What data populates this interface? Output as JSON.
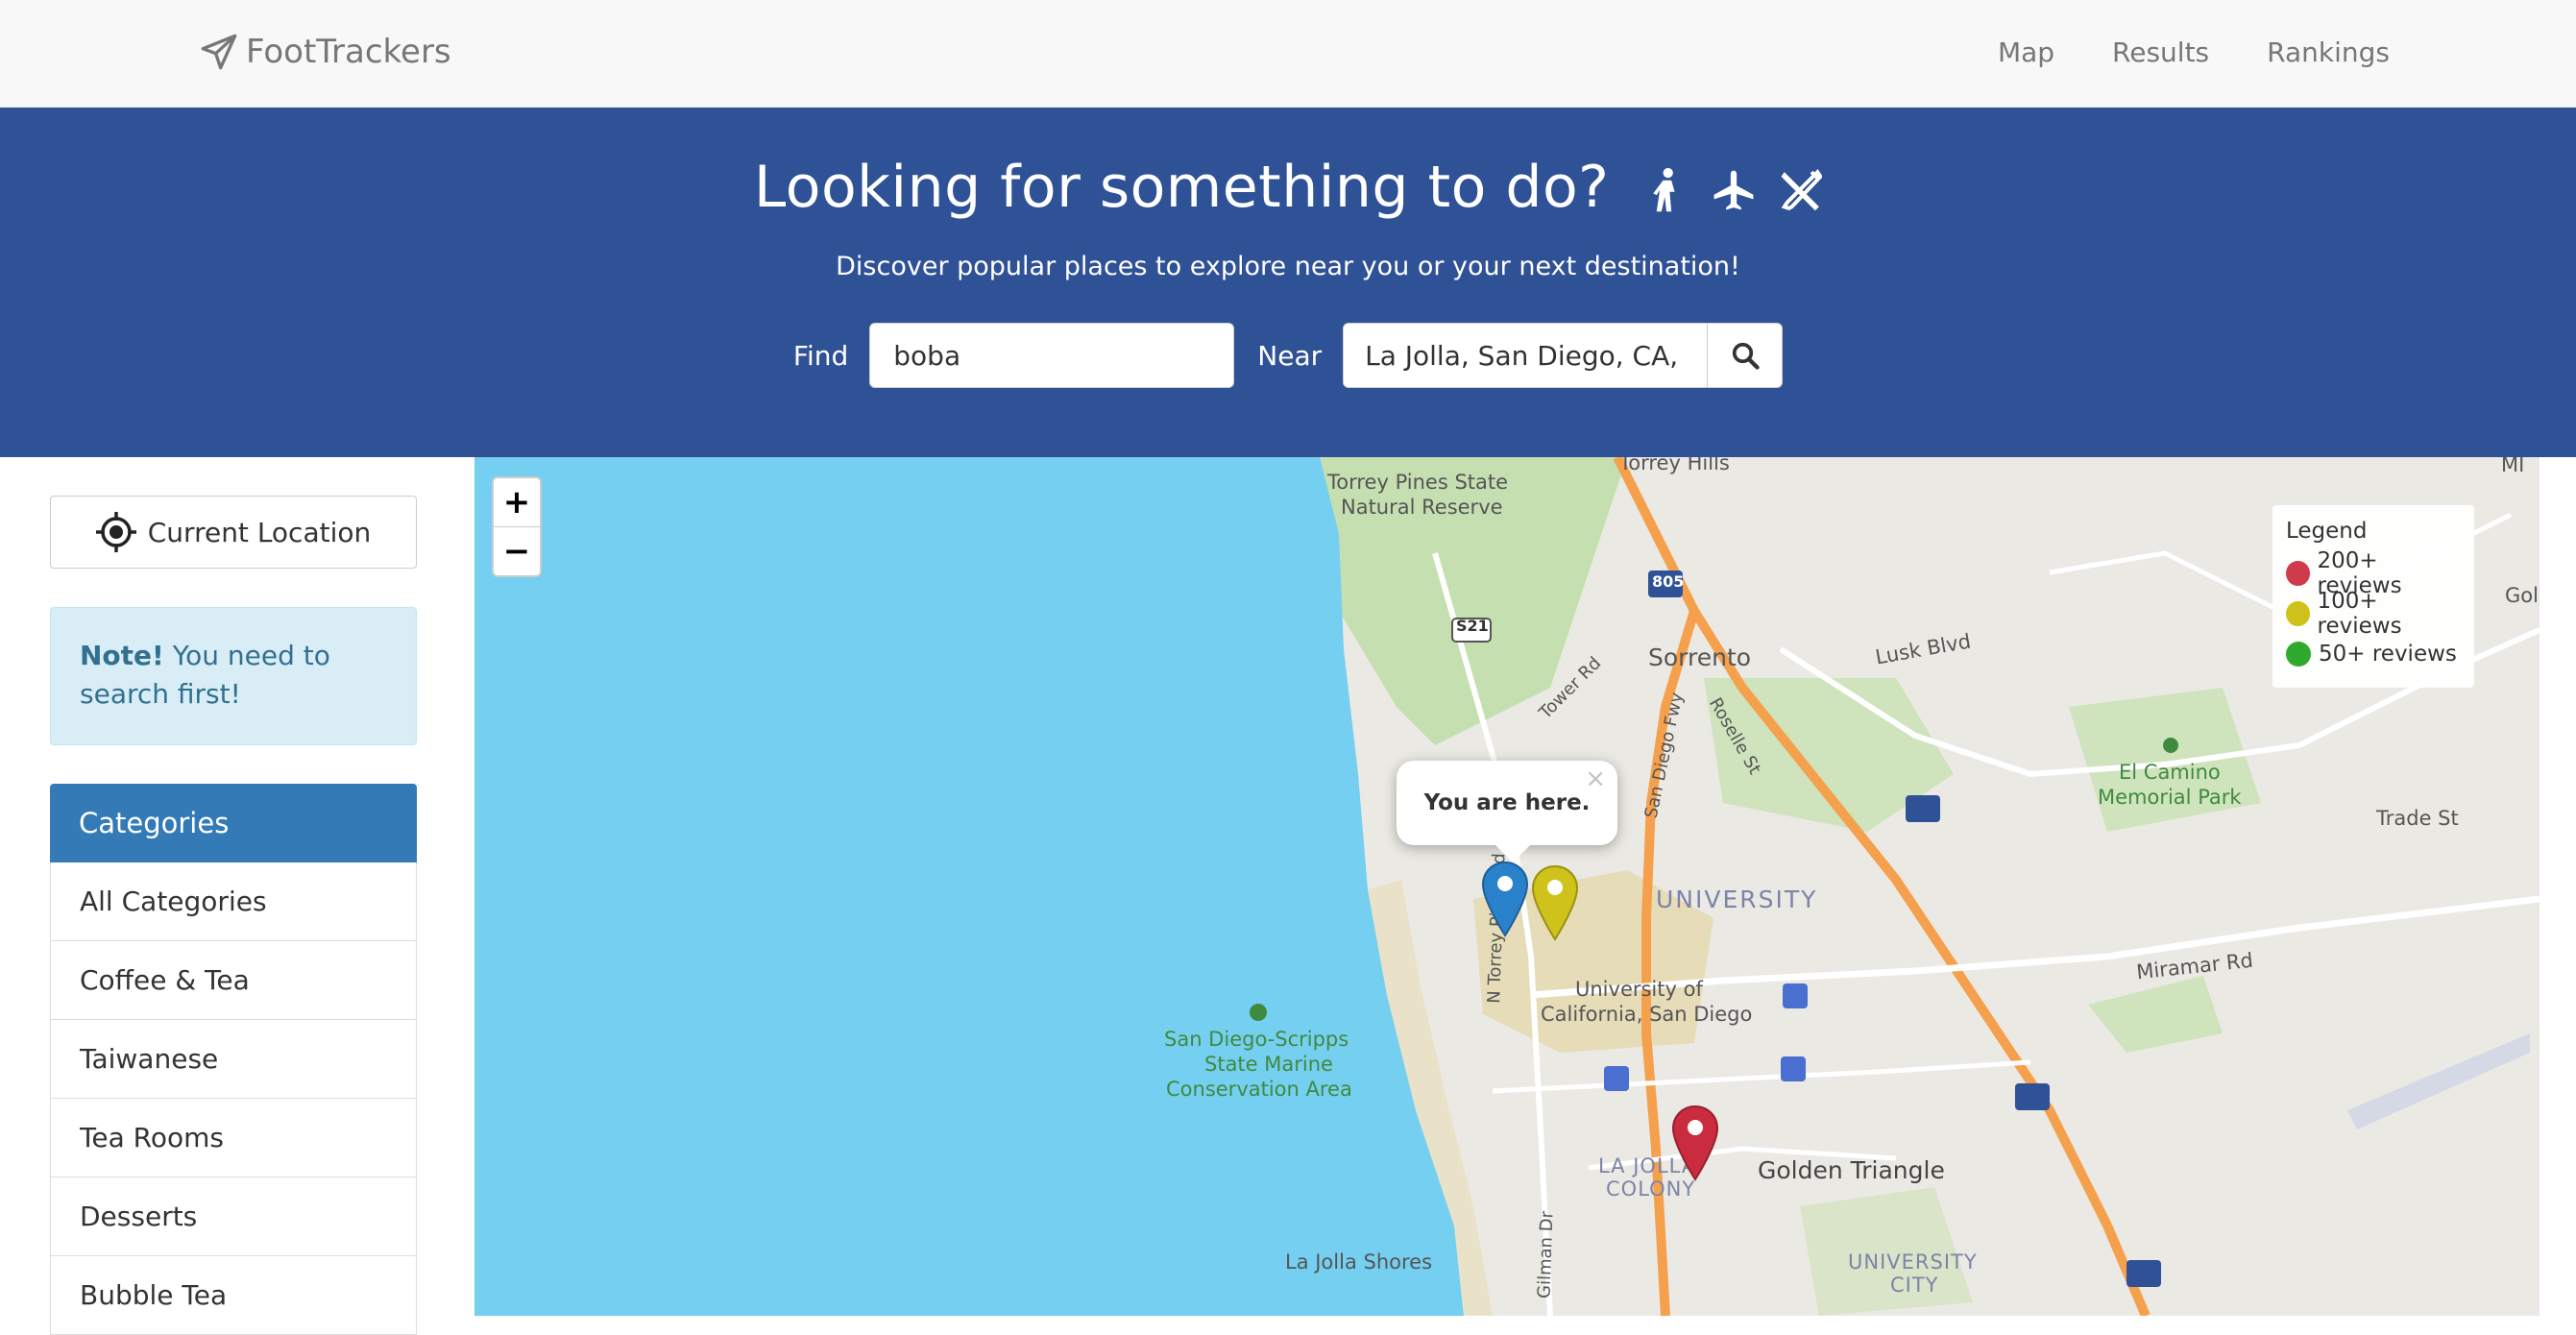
{
  "navbar": {
    "brand": "FootTrackers",
    "links": [
      "Map",
      "Results",
      "Rankings"
    ]
  },
  "hero": {
    "title": "Looking for something to do?",
    "title_icons": [
      "walking-icon",
      "plane-icon",
      "utensils-icon"
    ],
    "subtitle": "Discover popular places to explore near you or your next destination!",
    "find_label": "Find",
    "find_value": "boba",
    "near_label": "Near",
    "near_value": "La Jolla, San Diego, CA, U"
  },
  "sidebar": {
    "current_location": "Current Location",
    "note_bold": "Note!",
    "note_text": " You need to search first!",
    "categories_title": "Categories",
    "categories": [
      "All Categories",
      "Coffee & Tea",
      "Taiwanese",
      "Tea Rooms",
      "Desserts",
      "Bubble Tea"
    ]
  },
  "map": {
    "zoom_in": "+",
    "zoom_out": "−",
    "popup_text": "You are here.",
    "popup_close": "×",
    "legend": {
      "title": "Legend",
      "items": [
        {
          "label": "200+ reviews",
          "color": "#d03b4c"
        },
        {
          "label": "100+ reviews",
          "color": "#cfc21a"
        },
        {
          "label": "50+ reviews",
          "color": "#2faa2f"
        }
      ]
    },
    "labels": {
      "torrey_hills": "Torrey Hills",
      "torrey_pines": "Torrey Pines State",
      "natural_reserve": "Natural Reserve",
      "sorrento": "Sorrento",
      "lusk": "Lusk Blvd",
      "tower": "Tower Rd",
      "roselle": "Roselle St",
      "sdfwy": "San Diego Fwy",
      "university": "UNIVERSITY",
      "ucsd1": "University of",
      "ucsd2": "California, San Diego",
      "sdscripps1": "San Diego-Scripps",
      "sdscripps2": "State Marine",
      "sdscripps3": "Conservation Area",
      "elcamino1": "El Camino",
      "elcamino2": "Memorial Park",
      "trade": "Trade St",
      "miramar": "Miramar Rd",
      "golden": "Golden Triangle",
      "lajolla1": "LA JOLLA",
      "lajolla2": "COLONY",
      "lajollashores": "La Jolla Shores",
      "ucity1": "UNIVERSITY",
      "ucity2": "CITY",
      "gilman": "Gilman Dr",
      "ntorrey": "N Torrey Pines Rd",
      "s21": "S21",
      "i805": "805",
      "mi": "MI",
      "gol": "Gol"
    },
    "markers": [
      {
        "name": "you-are-here-marker",
        "color": "#2a81cb"
      },
      {
        "name": "result-marker-100",
        "color": "#cfc21a"
      },
      {
        "name": "result-marker-200",
        "color": "#cb2b3e"
      }
    ]
  }
}
